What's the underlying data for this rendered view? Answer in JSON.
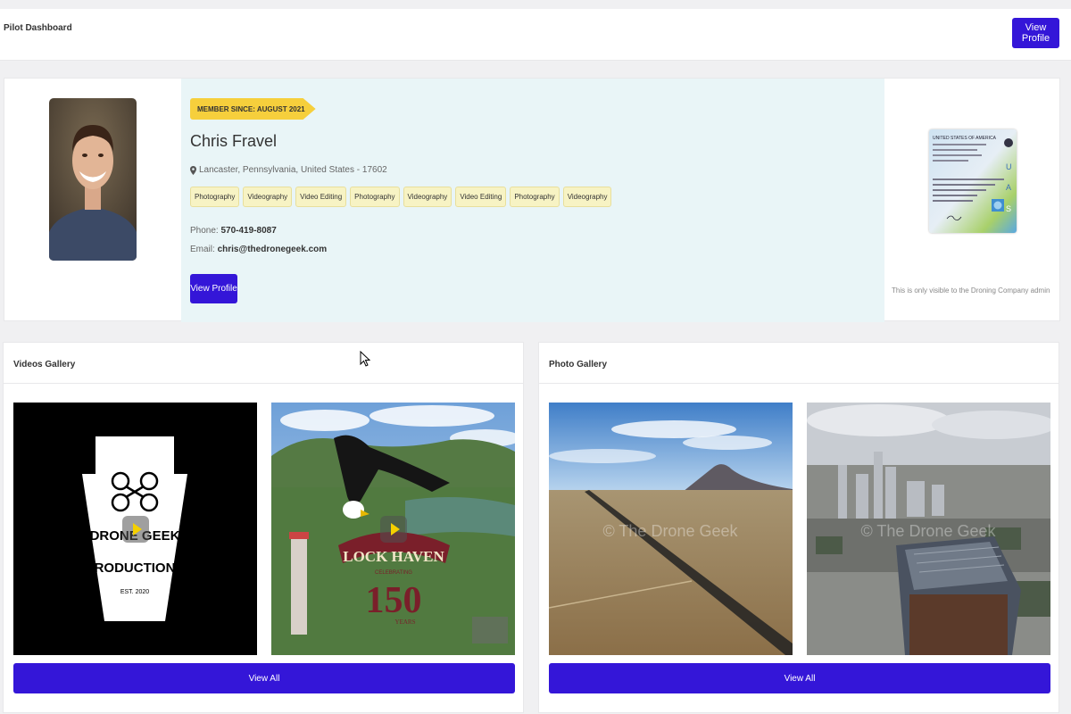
{
  "header": {
    "title": "Pilot Dashboard",
    "view_profile_label": "View Profile"
  },
  "profile": {
    "member_since": "MEMBER SINCE: AUGUST 2021",
    "name": "Chris Fravel",
    "location": "Lancaster, Pennsylvania, United States - 17602",
    "skills": [
      "Photography",
      "Videography",
      "Video Editing",
      "Photography",
      "Videography",
      "Video Editing",
      "Photography",
      "Videography"
    ],
    "phone_label": "Phone:",
    "phone": "570-419-8087",
    "email_label": "Email:",
    "email": "chris@thedronegeek.com",
    "view_profile_label": "View Profile",
    "license_note": "This is only visible to the Droning Company admin",
    "license_text": {
      "country": "UNITED STATES OF AMERICA",
      "letters": [
        "U",
        "A",
        "S"
      ]
    }
  },
  "videos": {
    "title": "Videos Gallery",
    "view_all_label": "View All",
    "items": [
      {
        "logo_lines": [
          "DRONE GEEK",
          "PRODUCTIONS",
          "EST. 2020"
        ]
      },
      {
        "logo_lines": [
          "LOCK HAVEN",
          "CELEBRATING",
          "150",
          "YEARS"
        ]
      }
    ]
  },
  "photos": {
    "title": "Photo Gallery",
    "view_all_label": "View All",
    "watermark": "© The Drone Geek"
  },
  "colors": {
    "accent": "#3416d8",
    "badge": "#f6cf3c",
    "info_bg": "#e9f5f7"
  }
}
